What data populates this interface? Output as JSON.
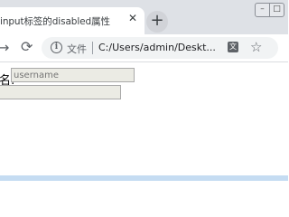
{
  "browser": {
    "tab": {
      "title": "input标签的disabled属性"
    },
    "new_tab_symbol": "+",
    "close_symbol": "✕",
    "window_controls": {
      "minimize": "–",
      "maximize": "□"
    },
    "omnibox": {
      "scheme_label": "文件",
      "url": "C:/Users/admin/Deskt..."
    },
    "icons": [
      "back-arrow-icon",
      "reload-icon",
      "info-icon",
      "translate-icon",
      "star-icon"
    ],
    "accent_color": "#c5dcf2"
  },
  "page": {
    "form": {
      "username_label": "名:",
      "username_placeholder": "username",
      "second_input_value": ""
    }
  }
}
